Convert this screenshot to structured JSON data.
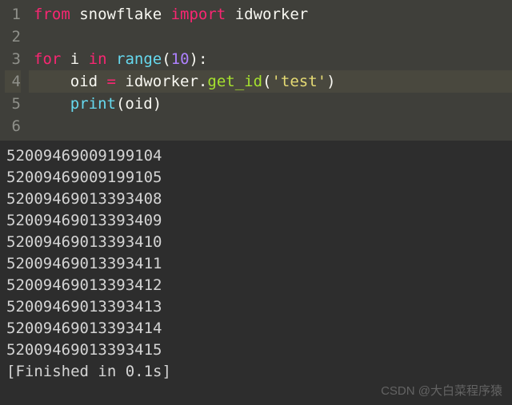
{
  "code": {
    "lines": [
      {
        "n": "1",
        "hl": false,
        "tokens": [
          {
            "cls": "kw",
            "t": "from"
          },
          {
            "cls": "name",
            "t": " snowflake "
          },
          {
            "cls": "kw",
            "t": "import"
          },
          {
            "cls": "name",
            "t": " idworker"
          }
        ]
      },
      {
        "n": "2",
        "hl": false,
        "tokens": []
      },
      {
        "n": "3",
        "hl": false,
        "tokens": [
          {
            "cls": "kw",
            "t": "for"
          },
          {
            "cls": "name",
            "t": " i "
          },
          {
            "cls": "kw",
            "t": "in"
          },
          {
            "cls": "name",
            "t": " "
          },
          {
            "cls": "fn",
            "t": "range"
          },
          {
            "cls": "punc",
            "t": "("
          },
          {
            "cls": "num",
            "t": "10"
          },
          {
            "cls": "punc",
            "t": "):"
          }
        ]
      },
      {
        "n": "4",
        "hl": true,
        "tokens": [
          {
            "cls": "name",
            "t": "    oid "
          },
          {
            "cls": "kw",
            "t": "="
          },
          {
            "cls": "name",
            "t": " idworker"
          },
          {
            "cls": "punc",
            "t": "."
          },
          {
            "cls": "call",
            "t": "get_id"
          },
          {
            "cls": "punc",
            "t": "("
          },
          {
            "cls": "str",
            "t": "'test'"
          },
          {
            "cls": "punc",
            "t": ")"
          }
        ]
      },
      {
        "n": "5",
        "hl": false,
        "tokens": [
          {
            "cls": "name",
            "t": "    "
          },
          {
            "cls": "fn",
            "t": "print"
          },
          {
            "cls": "punc",
            "t": "("
          },
          {
            "cls": "name",
            "t": "oid"
          },
          {
            "cls": "punc",
            "t": ")"
          }
        ]
      },
      {
        "n": "6",
        "hl": false,
        "tokens": []
      }
    ]
  },
  "output": {
    "lines": [
      "52009469009199104",
      "52009469009199105",
      "52009469013393408",
      "52009469013393409",
      "52009469013393410",
      "52009469013393411",
      "52009469013393412",
      "52009469013393413",
      "52009469013393414",
      "52009469013393415",
      "[Finished in 0.1s]"
    ]
  },
  "watermark": "CSDN @大白菜程序猿"
}
